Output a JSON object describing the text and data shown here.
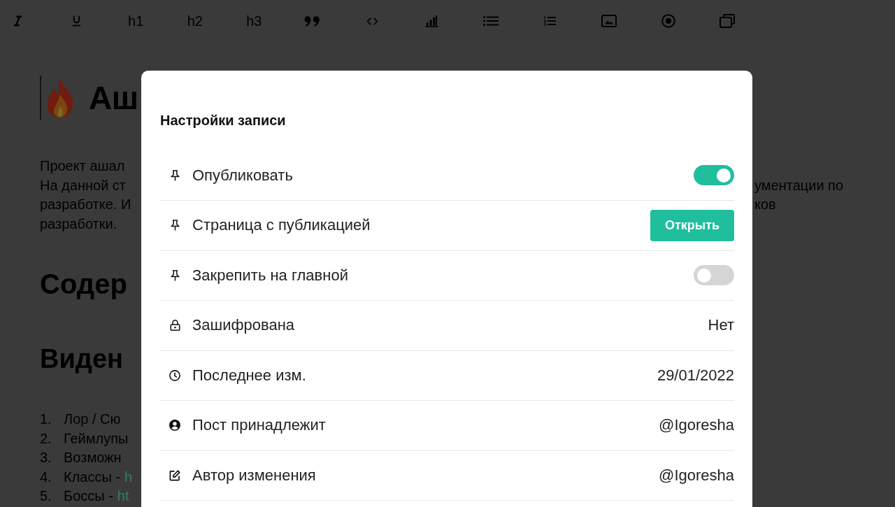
{
  "toolbar": {
    "buttons": [
      {
        "kind": "icon"
      },
      {
        "kind": "icon"
      },
      {
        "kind": "text",
        "label": "h1"
      },
      {
        "kind": "text",
        "label": "h2"
      },
      {
        "kind": "text",
        "label": "h3"
      },
      {
        "kind": "icon"
      },
      {
        "kind": "icon"
      },
      {
        "kind": "icon"
      },
      {
        "kind": "icon"
      },
      {
        "kind": "icon"
      },
      {
        "kind": "icon"
      },
      {
        "kind": "icon"
      },
      {
        "kind": "icon"
      }
    ]
  },
  "document": {
    "title": "Аш",
    "intro_left": [
      "Проект ашал",
      "На данной ст",
      "разработке. И",
      "разработки."
    ],
    "intro_right": [
      "ументации по",
      "ков"
    ],
    "headings": [
      "Содер",
      "Виден"
    ],
    "list": [
      {
        "number": "1.",
        "text": "Лор / Сю"
      },
      {
        "number": "2.",
        "text": "Геймлупы"
      },
      {
        "number": "3.",
        "text": "Возможн"
      },
      {
        "number": "4.",
        "text": "Классы -",
        "link": "h"
      },
      {
        "number": "5.",
        "text": "Боссы -",
        "link": "ht"
      }
    ]
  },
  "dialog": {
    "title": "Настройки записи",
    "rows": [
      {
        "kind": "toggle",
        "label": "Опубликовать",
        "on": true
      },
      {
        "kind": "button",
        "label": "Страница с публикацией",
        "button": "Открыть"
      },
      {
        "kind": "toggle",
        "label": "Закрепить на главной",
        "on": false
      },
      {
        "kind": "value",
        "label": "Зашифрована",
        "value": "Нет"
      },
      {
        "kind": "value",
        "label": "Последнее изм.",
        "value": "29/01/2022"
      },
      {
        "kind": "value",
        "label": "Пост принадлежит",
        "value": "@Igoresha"
      },
      {
        "kind": "value",
        "label": "Автор изменения",
        "value": "@Igoresha"
      }
    ]
  }
}
